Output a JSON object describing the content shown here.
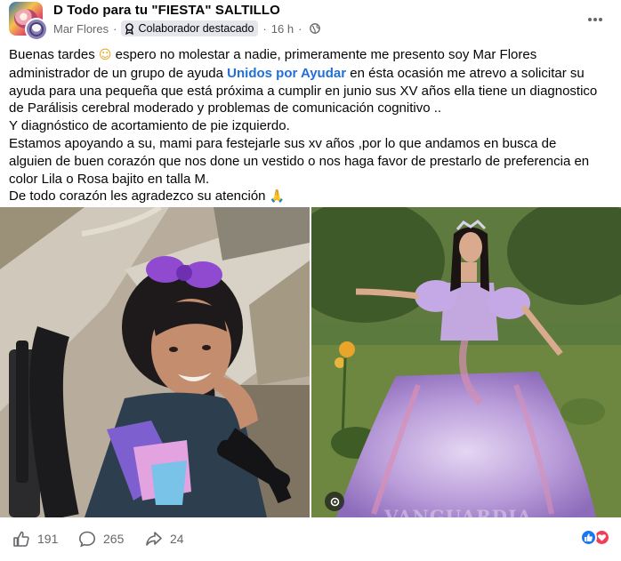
{
  "header": {
    "group_name": "D Todo para tu \"FIESTA\" SALTILLO",
    "author": "Mar Flores",
    "badge": "Colaborador destacado",
    "time": "16 h",
    "separator": "·"
  },
  "post": {
    "line1_a": "Buenas tardes ",
    "line1_emoji": "☺",
    "line1_b": " espero no molestar a nadie, primeramente me presento soy Mar Flores",
    "line2_a": "administrador de un grupo de ayuda ",
    "line2_link": "Unidos por Ayudar",
    "line2_b": " en ésta ocasión me atrevo a solicitar su",
    "line3": "ayuda para una pequeña que está próxima a cumplir en junio sus XV años ella tiene un diagnostico",
    "line4": "de Parálisis cerebral moderado y problemas de comunicación cognitivo ..",
    "line5": "Y diagnóstico de acortamiento de pie izquierdo.",
    "line6": "Estamos apoyando a su, mami para festejarle sus xv años ,por lo que andamos en busca de",
    "line7": "alguien de buen corazón que nos done un vestido o nos haga favor de prestarlo de preferencia en",
    "line8": "color Lila o Rosa bajito en talla M.",
    "line9_a": "De todo corazón les agradezco su atención ",
    "line9_emoji": "🙏"
  },
  "photos": {
    "watermark": "VANGUARDIA"
  },
  "footer": {
    "likes": "191",
    "comments": "265",
    "shares": "24"
  },
  "colors": {
    "link": "#216fdb",
    "muted": "#65676b",
    "like_blue": "#1877f2",
    "love_red": "#f33e58",
    "dress_lilac": "#b79ad8"
  },
  "icons": [
    "group-avatar",
    "user-avatar",
    "badge-icon",
    "globe-icon",
    "more-icon",
    "zoom-icon",
    "like-icon",
    "comment-icon",
    "share-icon",
    "like-reaction-icon",
    "love-reaction-icon"
  ]
}
